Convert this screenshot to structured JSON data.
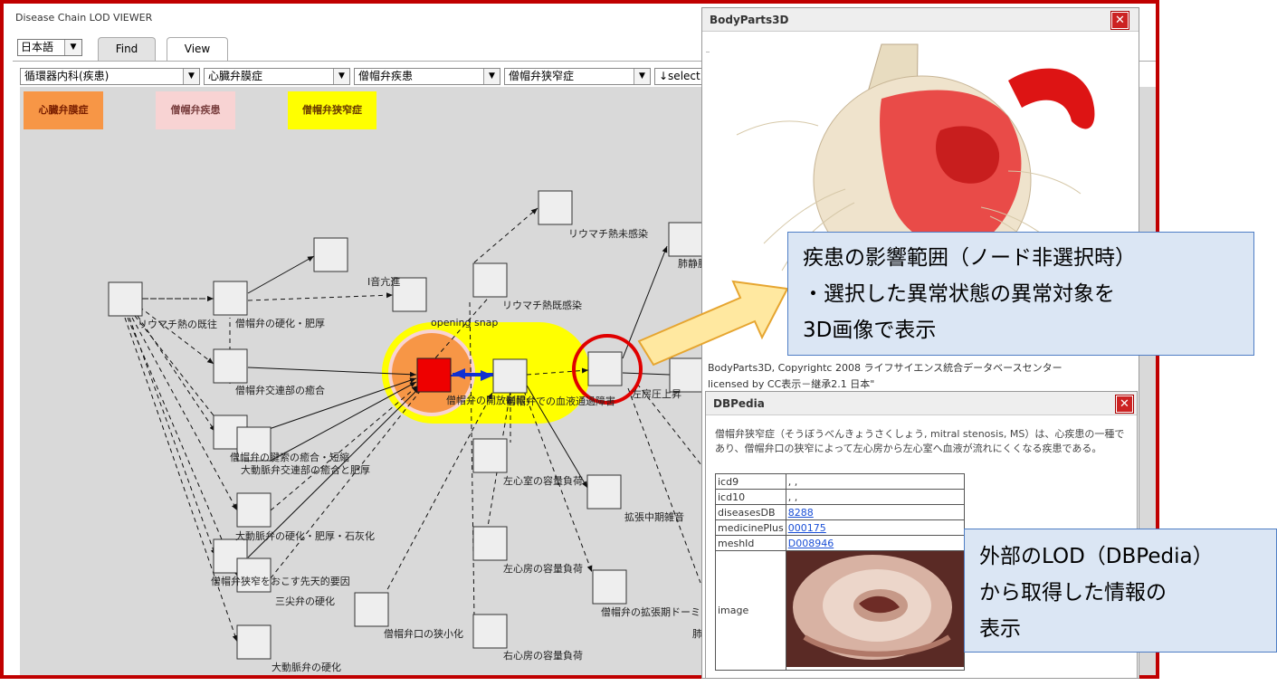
{
  "app_title": "Disease Chain LOD VIEWER",
  "language": "日本語",
  "tabs": {
    "find": "Find",
    "view": "View"
  },
  "dropdowns": [
    "循環器内科(疾患)",
    "心臓弁膜症",
    "僧帽弁疾患",
    "僧帽弁狭窄症",
    "↓select a"
  ],
  "legend": [
    {
      "label": "心臓弁膜症",
      "color": "#f79646"
    },
    {
      "label": "僧帽弁疾患",
      "color": "#f8d3d3"
    },
    {
      "label": "僧帽弁狭窄症",
      "color": "#ffff00"
    }
  ],
  "graph_labels": {
    "n1": "リウマチ熱の既往",
    "n2": "僧帽弁の硬化・肥厚",
    "n3": "I音亢進",
    "n4": "僧帽弁交連部の癒合",
    "n5": "僧帽弁の腱索の癒合・短縮",
    "n6": "大動脈弁交連部の癒合と肥厚",
    "n7": "大動脈弁の硬化・肥厚・石灰化",
    "n8": "僧帽弁狭窄をおこす先天的要因",
    "n9": "三尖弁の硬化",
    "n10": "大動脈弁の硬化",
    "n11": "opening snap",
    "n12": "僧帽弁の開放制限",
    "n13": "僧帽弁での血液通過障害",
    "n14": "リウマチ熱既感染",
    "n15": "リウマチ熱未感染",
    "n16": "肺静脈圧の上昇",
    "n17": "左房圧上昇",
    "n18": "左心室の容量負荷",
    "n19": "拡張中期雑音",
    "n20": "左心房の容量負荷",
    "n21": "僧帽弁口の狭小化",
    "n22": "右心房の容量負荷",
    "n23": "僧帽弁の拡張期ドーミング",
    "n24": "肺静"
  },
  "bodyparts": {
    "title": "BodyParts3D",
    "credit_line1": "BodyParts3D, Copyrightc 2008 ライフサイエンス統合データベースセンター",
    "credit_line2": "licensed by CC表示－継承2.1 日本\""
  },
  "dbpedia": {
    "title": "DBPedia",
    "description": "僧帽弁狭窄症（そうぼうべんきょうさくしょう, mitral stenosis, MS）は、心疾患の一種であり、僧帽弁口の狭窄によって左心房から左心室へ血液が流れにくくなる疾患である。",
    "rows": [
      {
        "key": "icd9",
        "value": ", ,",
        "link": false
      },
      {
        "key": "icd10",
        "value": ", ,",
        "link": false
      },
      {
        "key": "diseasesDB",
        "value": "8288",
        "link": true
      },
      {
        "key": "medicinePlus",
        "value": "000175",
        "link": true
      },
      {
        "key": "meshId",
        "value": "D008946",
        "link": true
      },
      {
        "key": "image",
        "value": "",
        "link": false
      }
    ]
  },
  "callout_scope": {
    "line1": "疾患の影響範囲（ノード非選択時）",
    "line2": "・選択した異常状態の異常対象を",
    "line3": "3D画像で表示"
  },
  "callout_lod": {
    "line1": "外部のLOD（DBPedia）",
    "line2": "から取得した情報の",
    "line3": "表示"
  }
}
